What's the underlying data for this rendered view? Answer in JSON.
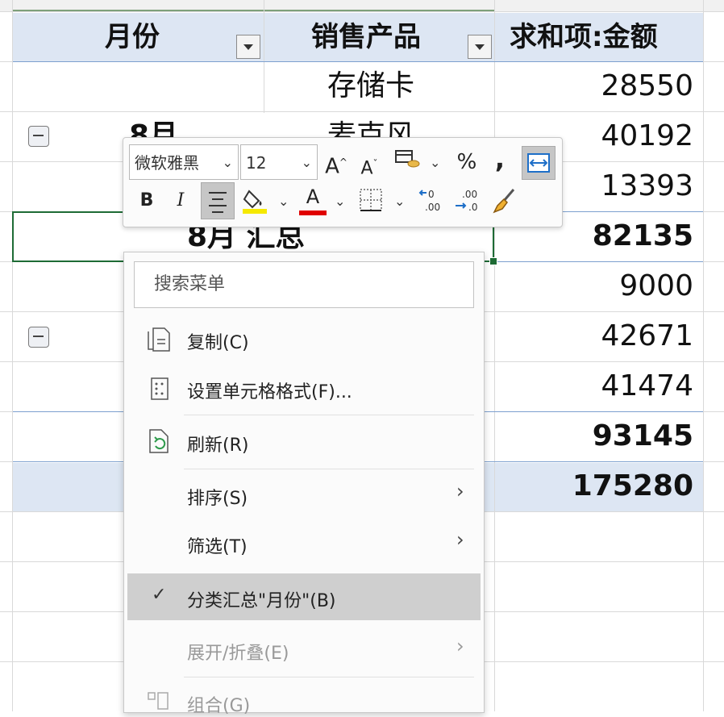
{
  "pivot": {
    "headers": {
      "month": "月份",
      "product": "销售产品",
      "sum": "求和项:金额"
    },
    "rows": [
      {
        "product": "存储卡",
        "amount": "28550"
      },
      {
        "product": "麦克风",
        "amount": "40192"
      },
      {
        "product": "",
        "amount": "13393"
      },
      {
        "product": "",
        "amount": "82135"
      },
      {
        "product": "",
        "amount": "9000"
      },
      {
        "product": "",
        "amount": "42671"
      },
      {
        "product": "",
        "amount": "41474"
      },
      {
        "product": "",
        "amount": "93145"
      },
      {
        "product": "",
        "amount": "175280"
      }
    ],
    "group1_label": "8月",
    "group1_subtotal_label": "8月 汇总"
  },
  "mini_toolbar": {
    "font_name": "微软雅黑",
    "font_size": "12",
    "bold": "B",
    "italic": "I",
    "font_color_glyph": "A",
    "grow_font_glyph": "A",
    "shrink_font_glyph": "A",
    "percent": "%",
    "comma": ",",
    "fill_color": "#f5e900",
    "font_color": "#e00000"
  },
  "context_menu": {
    "search_placeholder": "搜索菜单",
    "items": [
      {
        "label": "复制(C)",
        "icon": "copy-icon"
      },
      {
        "label": "设置单元格格式(F)...",
        "icon": "format-cells-icon"
      },
      {
        "label": "刷新(R)",
        "icon": "refresh-icon"
      },
      {
        "label": "排序(S)",
        "submenu": true
      },
      {
        "label": "筛选(T)",
        "submenu": true
      },
      {
        "label": "分类汇总\"月份\"(B)",
        "checked": true
      },
      {
        "label": "展开/折叠(E)",
        "submenu": true,
        "disabled": true
      },
      {
        "label": "组合(G)",
        "icon": "group-icon",
        "disabled": true
      }
    ]
  }
}
